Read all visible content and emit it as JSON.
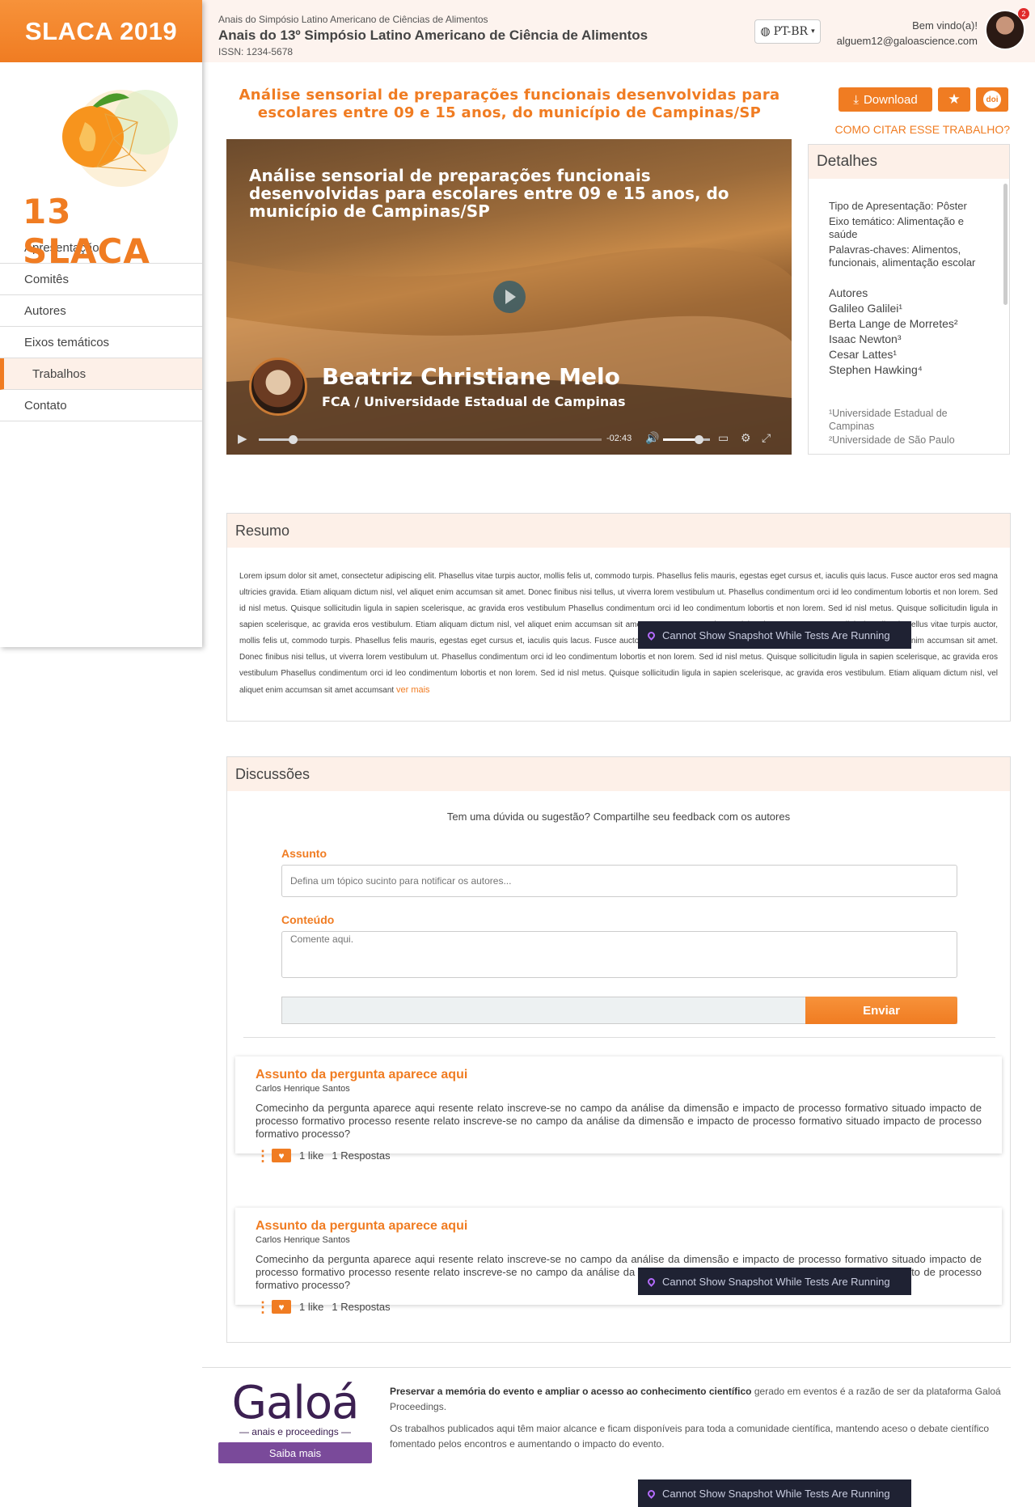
{
  "sidebar": {
    "brand": "SLACA 2019",
    "logo_text": "13 SLACA",
    "nav": [
      {
        "label": "Apresentação",
        "active": false
      },
      {
        "label": "Comitês",
        "active": false
      },
      {
        "label": "Autores",
        "active": false
      },
      {
        "label": "Eixos temáticos",
        "active": false
      },
      {
        "label": "Trabalhos",
        "active": true
      },
      {
        "label": "Contato",
        "active": false
      }
    ]
  },
  "header": {
    "subtitle": "Anais do Simpósio Latino Americano de Ciências de Alimentos",
    "title": "Anais do 13º Simpósio Latino Americano de Ciência de Alimentos",
    "issn": "ISSN: 1234-5678",
    "language": "PT-BR",
    "welcome": "Bem vindo(a)!",
    "user_email": "alguem12@galoascience.com",
    "notification_count": "2"
  },
  "paper": {
    "title": "Análise sensorial de preparações funcionais desenvolvidas para escolares entre 09 e 15 anos, do município de Campinas/SP",
    "download_label": "Download",
    "doi_label": "doi",
    "cite_label": "COMO CITAR ESSE TRABALHO?"
  },
  "video": {
    "title": "Análise sensorial de preparações funcionais desenvolvidas para escolares entre 09 e 15 anos, do município de Campinas/SP",
    "presenter": "Beatriz Christiane Melo",
    "affiliation": "FCA / Universidade Estadual de Campinas",
    "time_remaining": "-02:43",
    "progress": 0.1,
    "volume": 0.75
  },
  "details": {
    "heading": "Detalhes",
    "presentation_type": "Tipo de Apresentação: Pôster",
    "theme": "Eixo temático: Alimentação e saúde",
    "keywords": "Palavras-chaves: Alimentos, funcionais, alimentação escolar",
    "authors_heading": "Autores",
    "authors": [
      "Galileo Galilei¹",
      "Berta Lange de Morretes²",
      "Isaac Newton³",
      "Cesar Lattes¹",
      "Stephen Hawking⁴"
    ],
    "affiliations": [
      "¹Universidade Estadual de Campinas",
      "²Universidade de São Paulo"
    ]
  },
  "resumo": {
    "heading": "Resumo",
    "text": "Lorem ipsum dolor sit amet, consectetur adipiscing elit. Phasellus vitae turpis auctor, mollis felis ut, commodo turpis. Phasellus felis mauris, egestas eget cursus et, iaculis quis lacus. Fusce auctor eros sed magna ultricies gravida. Etiam aliquam dictum nisl, vel aliquet enim accumsan sit amet. Donec finibus nisi tellus, ut viverra lorem vestibulum ut. Phasellus condimentum orci id leo condimentum lobortis et non lorem. Sed id nisl metus. Quisque sollicitudin ligula in sapien scelerisque, ac gravida eros vestibulum Phasellus condimentum orci id leo condimentum lobortis et non lorem. Sed id nisl metus. Quisque sollicitudin ligula in sapien scelerisque, ac gravida eros vestibulum. Etiam aliquam dictum nisl, vel aliquet enim accumsan sit amet accumsant Lorem ipsum dolor sit amet, consectetur adipiscing elit. Phasellus vitae turpis auctor, mollis felis ut, commodo turpis. Phasellus felis mauris, egestas eget cursus et, iaculis quis lacus. Fusce auctor eros sed magna ultricies gravida. Etiam aliquam dictum nisl, vel aliquet enim accumsan sit amet. Donec finibus nisi tellus, ut viverra lorem vestibulum ut. Phasellus condimentum orci id leo condimentum lobortis et non lorem. Sed id nisl metus. Quisque sollicitudin ligula in sapien scelerisque, ac gravida eros vestibulum Phasellus condimentum orci id leo condimentum lobortis et non lorem. Sed id nisl metus. Quisque sollicitudin ligula in sapien scelerisque, ac gravida eros vestibulum. Etiam aliquam dictum nisl, vel aliquet enim accumsan sit amet accumsant",
    "more_label": "ver mais"
  },
  "discussoes": {
    "heading": "Discussões",
    "prompt": "Tem uma dúvida ou sugestão? Compartilhe seu feedback com os autores",
    "subject_label": "Assunto",
    "subject_placeholder": "Defina um tópico sucinto para notificar os autores...",
    "content_label": "Conteúdo",
    "content_placeholder": "Comente aqui.",
    "send_label": "Enviar",
    "threads": [
      {
        "title": "Assunto da pergunta aparece aqui",
        "author": "Carlos Henrique Santos",
        "text": "Comecinho da pergunta aparece aqui resente relato inscreve-se no campo da análise da dimensão e impacto de processo formativo situado impacto de processo formativo processo resente relato inscreve-se no campo da análise da dimensão e impacto de processo formativo situado impacto de processo formativo processo?",
        "likes": "1 like",
        "replies": "1 Respostas"
      },
      {
        "title": "Assunto da pergunta aparece aqui",
        "author": "Carlos Henrique Santos",
        "text": "Comecinho da pergunta aparece aqui resente relato inscreve-se no campo da análise da dimensão e impacto de processo formativo situado impacto de processo formativo processo resente relato inscreve-se no campo da análise da dimensão e impacto de processo formativo situado impacto de processo formativo processo?",
        "likes": "1 like",
        "replies": "1 Respostas"
      }
    ]
  },
  "footer": {
    "logo": "Galoá",
    "logo_sub": "— anais e proceedings —",
    "button": "Saiba mais",
    "p1_bold": "Preservar a memória do evento e ampliar o acesso ao conhecimento científico",
    "p1_rest": " gerado em eventos é a razão de ser da plataforma Galoá Proceedings.",
    "p2": "Os trabalhos publicados aqui têm maior alcance e ficam disponíveis para toda a comunidade científica, mantendo aceso o debate científico fomentado pelos encontros e aumentando o impacto do evento."
  },
  "toast": {
    "text": "Cannot Show Snapshot While Tests Are Running"
  },
  "colors": {
    "accent": "#f07c22",
    "panel_bg": "#fdf0e8",
    "footer_brand": "#3c2052"
  }
}
